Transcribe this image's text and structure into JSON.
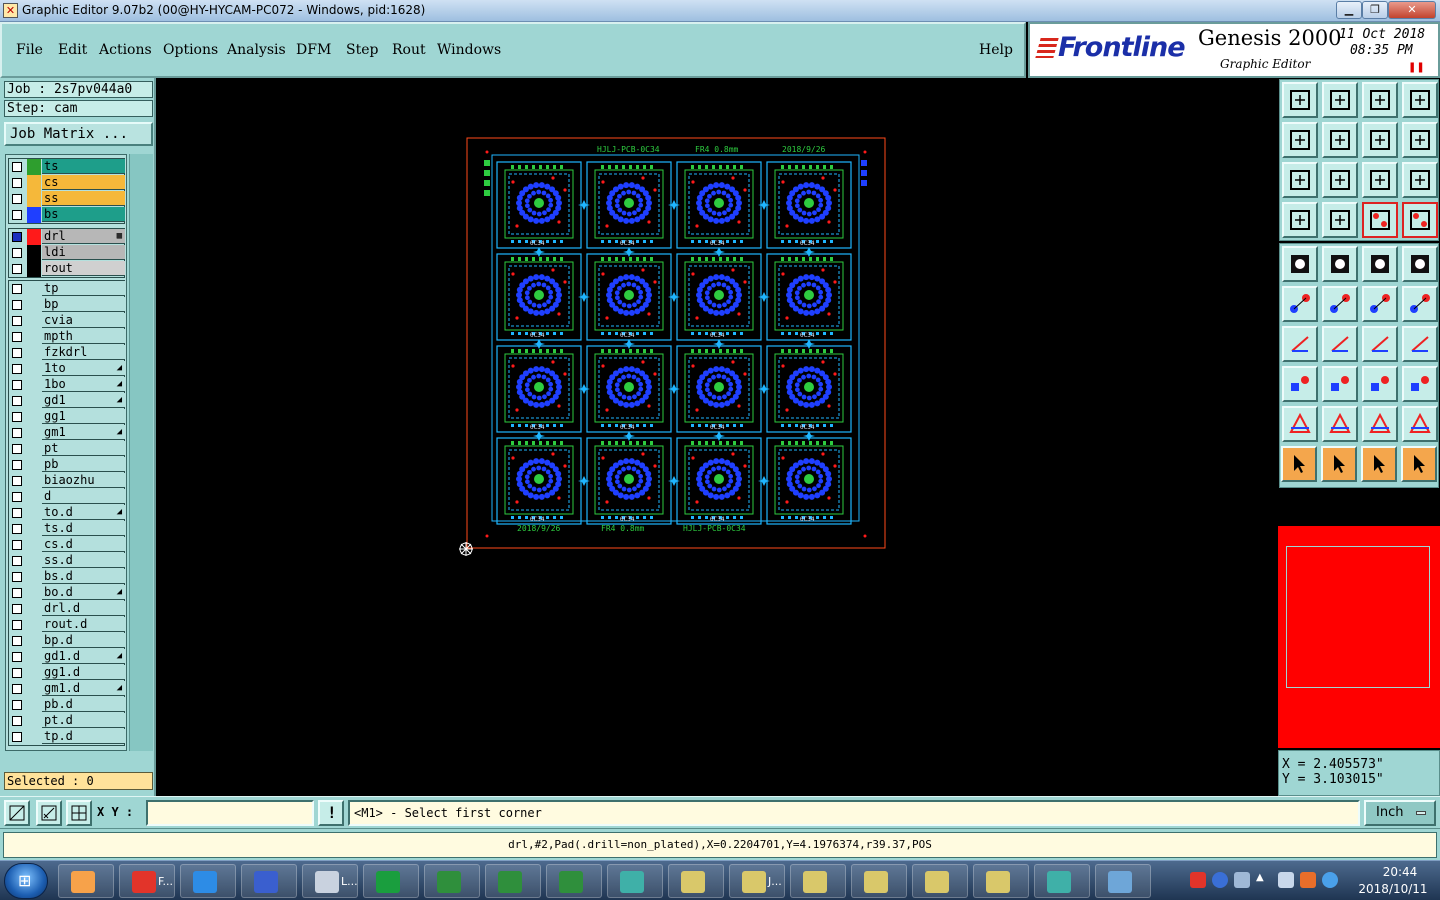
{
  "window": {
    "title": "Graphic Editor 9.07b2 (00@HY-HYCAM-PC072 - Windows, pid:1628)"
  },
  "menu": {
    "file": "File",
    "edit": "Edit",
    "actions": "Actions",
    "options": "Options",
    "analysis": "Analysis",
    "dfm": "DFM",
    "step": "Step",
    "rout": "Rout",
    "windows": "Windows",
    "help": "Help"
  },
  "brand": {
    "logo": "Frontline",
    "product": "Genesis 2000",
    "subtitle": "Graphic Editor",
    "date": "11 Oct 2018",
    "time": "08:35 PM",
    "pause": "❚❚"
  },
  "job": {
    "job_label": "Job : 2s7pv044a0",
    "step_label": "Step: cam",
    "matrix_button": "Job Matrix ..."
  },
  "layers": {
    "group1": [
      {
        "name": "ts",
        "color": "#2e9e2e",
        "bg": "#1e9e8a"
      },
      {
        "name": "cs",
        "color": "#f5b83a",
        "bg": "#f5b83a"
      },
      {
        "name": "ss",
        "color": "#f5b83a",
        "bg": "#f5b83a"
      },
      {
        "name": "bs",
        "color": "#1f3fff",
        "bg": "#1e9e8a"
      }
    ],
    "group2": [
      {
        "name": "drl",
        "color": "#ff1a1a",
        "bg": "#b7b7b7",
        "flag": "▦",
        "active": true
      },
      {
        "name": "ldi",
        "color": "#000000",
        "bg": "#b7b7b7"
      },
      {
        "name": "rout",
        "color": "#000000",
        "bg": "#d0d0d0"
      }
    ],
    "group3": [
      {
        "name": "tp"
      },
      {
        "name": "bp"
      },
      {
        "name": "cvia"
      },
      {
        "name": "mpth"
      },
      {
        "name": "fzkdrl"
      },
      {
        "name": "1to",
        "flag": "◢"
      },
      {
        "name": "1bo",
        "flag": "◢"
      },
      {
        "name": "gd1",
        "flag": "◢"
      },
      {
        "name": "gg1"
      },
      {
        "name": "gm1",
        "flag": "◢"
      },
      {
        "name": "pt"
      },
      {
        "name": "pb"
      },
      {
        "name": "biaozhu"
      },
      {
        "name": "d"
      },
      {
        "name": "to.d",
        "flag": "◢"
      },
      {
        "name": "ts.d"
      },
      {
        "name": "cs.d"
      },
      {
        "name": "ss.d"
      },
      {
        "name": "bs.d"
      },
      {
        "name": "bo.d",
        "flag": "◢"
      },
      {
        "name": "drl.d"
      },
      {
        "name": "rout.d"
      },
      {
        "name": "bp.d"
      },
      {
        "name": "gd1.d",
        "flag": "◢"
      },
      {
        "name": "gg1.d"
      },
      {
        "name": "gm1.d",
        "flag": "◢"
      },
      {
        "name": "pb.d"
      },
      {
        "name": "pt.d"
      },
      {
        "name": "tp.d"
      }
    ],
    "selected_label": "Selected : 0"
  },
  "board": {
    "top_texts": [
      "HJLJ-PCB-0C34",
      "FR4  0.8mm",
      "2018/9/26"
    ],
    "bottom_texts": [
      "2018/9/26",
      "FR4  0.8mm",
      "HJLJ-PCB-0C34"
    ],
    "unit_label": "0C34",
    "colors": {
      "outline": "#ff4a1a",
      "trace": "#1fb6ff",
      "pad": "#1f3fff",
      "silk": "#2ecc40",
      "drill": "#ff1a1a"
    }
  },
  "coords": {
    "x": "X = 2.405573\"",
    "y": "Y = 3.103015\""
  },
  "command": {
    "xy_label": "X Y :",
    "xy_value": "",
    "prompt": "<M1> - Select first corner",
    "unit": "Inch",
    "warn": "!"
  },
  "status": {
    "text": "drl,#2,Pad(.drill=non_plated),X=0.2204701,Y=4.1976374,r39.37,POS"
  },
  "taskbar": {
    "tasks": [
      {
        "icon": "shell-icon",
        "color": "#f7a24a",
        "label": ""
      },
      {
        "icon": "genesis-icon",
        "color": "#e2342a",
        "label": "F..."
      },
      {
        "icon": "ie-icon",
        "color": "#2d8ce6",
        "label": ""
      },
      {
        "icon": "floppy-icon",
        "color": "#3a5fcf",
        "label": ""
      },
      {
        "icon": "notepad-icon",
        "color": "#c9d2df",
        "label": "L..."
      },
      {
        "icon": "frontline-icon",
        "color": "#1a9e3e",
        "label": ""
      },
      {
        "icon": "excel-icon",
        "color": "#2f8f3c",
        "label": ""
      },
      {
        "icon": "excel-icon",
        "color": "#2f8f3c",
        "label": ""
      },
      {
        "icon": "excel-icon",
        "color": "#2f8f3c",
        "label": ""
      },
      {
        "icon": "eye-icon",
        "color": "#3fb0a8",
        "label": ""
      },
      {
        "icon": "x-window-icon",
        "color": "#d9c86a",
        "label": ""
      },
      {
        "icon": "x-window-icon",
        "color": "#d9c86a",
        "label": "J..."
      },
      {
        "icon": "x-window-icon",
        "color": "#d9c86a",
        "label": ""
      },
      {
        "icon": "x-window-icon",
        "color": "#d9c86a",
        "label": ""
      },
      {
        "icon": "x-window-icon",
        "color": "#d9c86a",
        "label": ""
      },
      {
        "icon": "x-window-icon",
        "color": "#d9c86a",
        "label": ""
      },
      {
        "icon": "eye-icon",
        "color": "#3fb0a8",
        "label": ""
      },
      {
        "icon": "monitor-icon",
        "color": "#6ea6d8",
        "label": ""
      }
    ],
    "time": "20:44",
    "date": "2018/10/11"
  }
}
